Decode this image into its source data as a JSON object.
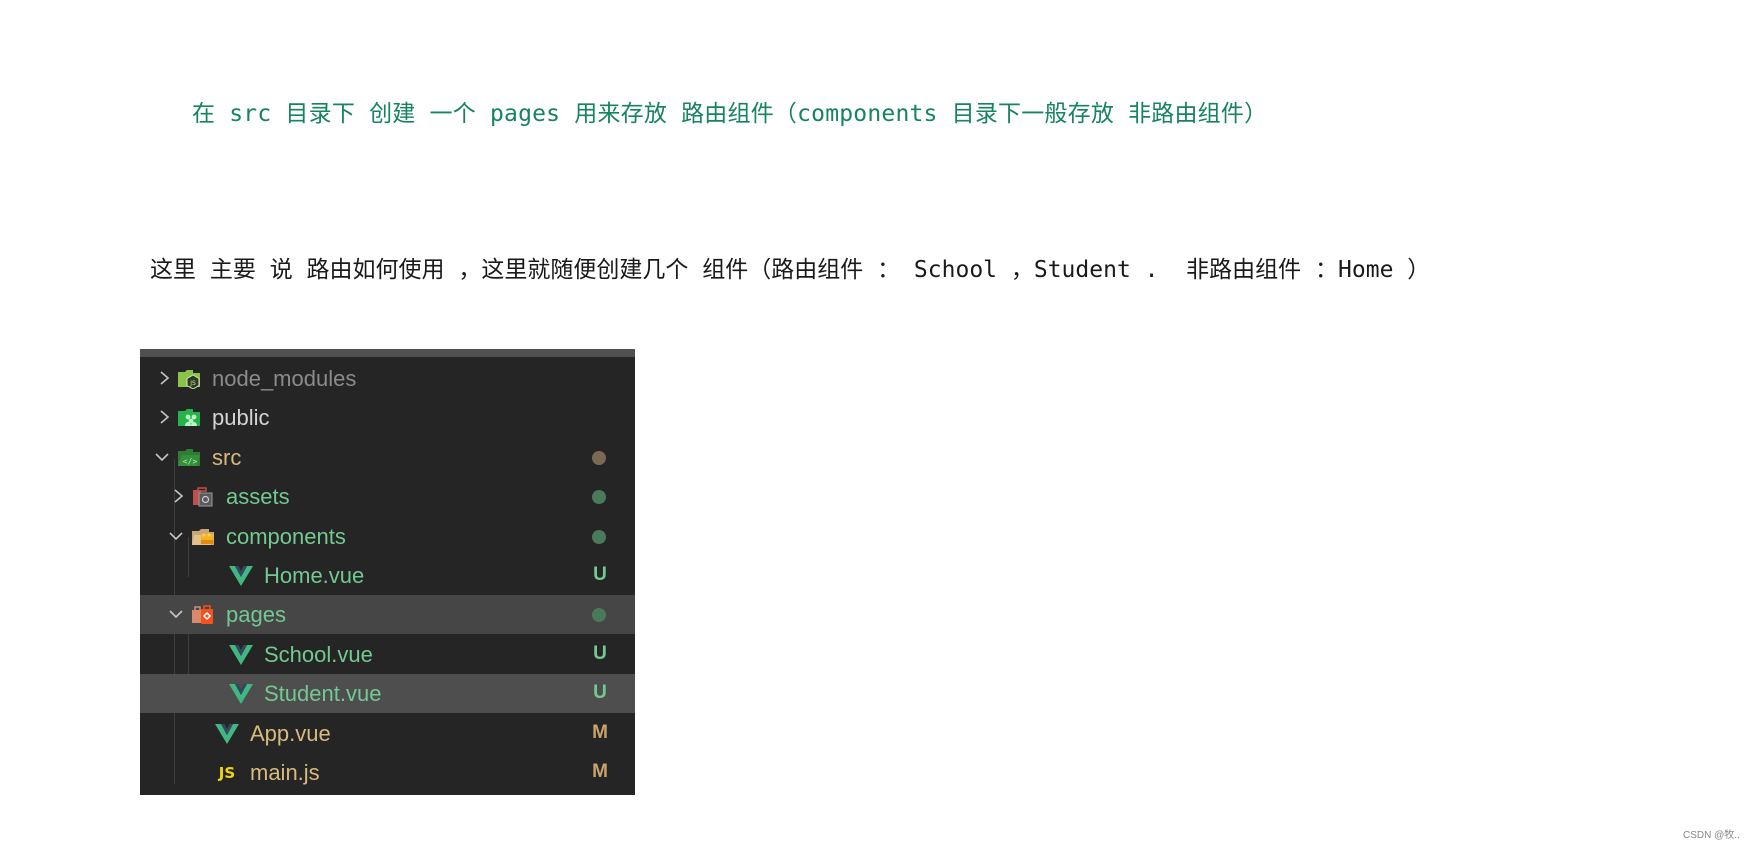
{
  "intro": {
    "line1": "在 src 目录下 创建 一个 pages 用来存放 路由组件（components 目录下一般存放 非路由组件）",
    "line2": "这里 主要 说 路由如何使用 ，这里就随便创建几个 组件（路由组件 ： School ，Student .  非路由组件 ：Home ）"
  },
  "explorer": {
    "items": [
      {
        "name": "node_modules",
        "type": "folder",
        "icon": "nodejs-folder-icon",
        "expanded": false,
        "depth": 0,
        "color": "#8b8b8b",
        "status": ""
      },
      {
        "name": "public",
        "type": "folder",
        "icon": "public-folder-icon",
        "expanded": false,
        "depth": 0,
        "color": "#d4d4d4",
        "status": ""
      },
      {
        "name": "src",
        "type": "folder",
        "icon": "src-folder-icon",
        "expanded": true,
        "depth": 0,
        "color": "#d7ba7d",
        "status": "dot-modified"
      },
      {
        "name": "assets",
        "type": "folder",
        "icon": "assets-folder-icon",
        "expanded": false,
        "depth": 1,
        "color": "#73c991",
        "status": "dot-untracked"
      },
      {
        "name": "components",
        "type": "folder",
        "icon": "components-folder-icon",
        "expanded": true,
        "depth": 1,
        "color": "#73c991",
        "status": "dot-untracked"
      },
      {
        "name": "Home.vue",
        "type": "file",
        "icon": "vue-file-icon",
        "depth": 2,
        "color": "#73c991",
        "status": "U"
      },
      {
        "name": "pages",
        "type": "folder",
        "icon": "pages-folder-icon",
        "expanded": true,
        "depth": 1,
        "color": "#73c991",
        "status": "dot-untracked",
        "highlight": "selected"
      },
      {
        "name": "School.vue",
        "type": "file",
        "icon": "vue-file-icon",
        "depth": 2,
        "color": "#73c991",
        "status": "U"
      },
      {
        "name": "Student.vue",
        "type": "file",
        "icon": "vue-file-icon",
        "depth": 2,
        "color": "#73c991",
        "status": "U",
        "highlight": "hover"
      },
      {
        "name": "App.vue",
        "type": "file",
        "icon": "vue-file-icon",
        "depth": 1,
        "color": "#d7ba7d",
        "status": "M"
      },
      {
        "name": "main.js",
        "type": "file",
        "icon": "js-file-icon",
        "depth": 1,
        "color": "#d7ba7d",
        "status": "M"
      }
    ],
    "status_colors": {
      "U": "#73c991",
      "M": "#c9a26d",
      "dot-modified": "#7a6a55",
      "dot-untracked": "#4a7a5a"
    }
  },
  "watermark": "CSDN @牧.."
}
